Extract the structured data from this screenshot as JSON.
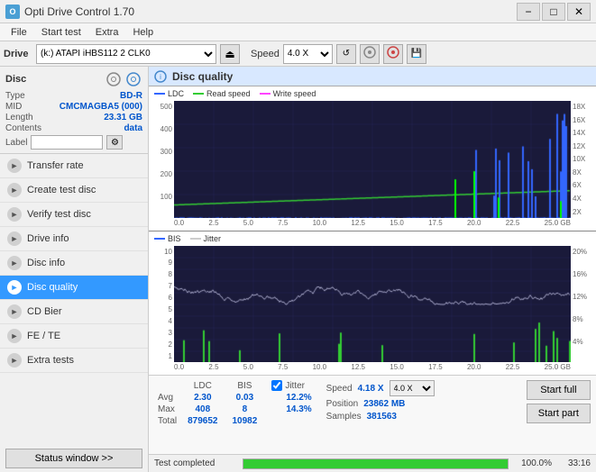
{
  "titlebar": {
    "title": "Opti Drive Control 1.70",
    "icon_text": "O",
    "minimize_label": "−",
    "maximize_label": "□",
    "close_label": "✕"
  },
  "menubar": {
    "items": [
      "File",
      "Start test",
      "Extra",
      "Help"
    ]
  },
  "drive": {
    "label": "Drive",
    "value": "(k:)  ATAPI iHBS112  2 CLK0",
    "speed_label": "Speed",
    "speed_value": "4.0 X"
  },
  "disc": {
    "section_title": "Disc",
    "type_label": "Type",
    "type_value": "BD-R",
    "mid_label": "MID",
    "mid_value": "CMCMAGBA5 (000)",
    "length_label": "Length",
    "length_value": "23.31 GB",
    "contents_label": "Contents",
    "contents_value": "data",
    "label_label": "Label",
    "label_value": ""
  },
  "nav": {
    "items": [
      {
        "id": "transfer-rate",
        "label": "Transfer rate",
        "active": false
      },
      {
        "id": "create-test-disc",
        "label": "Create test disc",
        "active": false
      },
      {
        "id": "verify-test-disc",
        "label": "Verify test disc",
        "active": false
      },
      {
        "id": "drive-info",
        "label": "Drive info",
        "active": false
      },
      {
        "id": "disc-info",
        "label": "Disc info",
        "active": false
      },
      {
        "id": "disc-quality",
        "label": "Disc quality",
        "active": true
      },
      {
        "id": "cd-bier",
        "label": "CD Bier",
        "active": false
      },
      {
        "id": "fe-te",
        "label": "FE / TE",
        "active": false
      },
      {
        "id": "extra-tests",
        "label": "Extra tests",
        "active": false
      }
    ]
  },
  "status_btn": "Status window >>",
  "quality": {
    "title": "Disc quality",
    "legend": {
      "ldc_label": "LDC",
      "read_speed_label": "Read speed",
      "write_speed_label": "Write speed",
      "bis_label": "BIS",
      "jitter_label": "Jitter"
    }
  },
  "chart_top": {
    "y_labels_left": [
      "500",
      "400",
      "300",
      "200",
      "100",
      "0.0"
    ],
    "y_labels_right": [
      "18X",
      "16X",
      "14X",
      "12X",
      "10X",
      "8X",
      "6X",
      "4X",
      "2X"
    ],
    "x_labels": [
      "0.0",
      "2.5",
      "5.0",
      "7.5",
      "10.0",
      "12.5",
      "15.0",
      "17.5",
      "20.0",
      "22.5",
      "25.0 GB"
    ]
  },
  "chart_bottom": {
    "y_labels_left": [
      "10",
      "9",
      "8",
      "7",
      "6",
      "5",
      "4",
      "3",
      "2",
      "1"
    ],
    "y_labels_right": [
      "20%",
      "16%",
      "12%",
      "8%",
      "4%"
    ],
    "x_labels": [
      "0.0",
      "2.5",
      "5.0",
      "7.5",
      "10.0",
      "12.5",
      "15.0",
      "17.5",
      "20.0",
      "22.5",
      "25.0 GB"
    ]
  },
  "stats": {
    "headers": [
      "LDC",
      "BIS",
      "",
      "Jitter",
      "Speed"
    ],
    "avg_label": "Avg",
    "avg_ldc": "2.30",
    "avg_bis": "0.03",
    "avg_jitter": "12.2%",
    "max_label": "Max",
    "max_ldc": "408",
    "max_bis": "8",
    "max_jitter": "14.3%",
    "total_label": "Total",
    "total_ldc": "879652",
    "total_bis": "10982",
    "speed_label": "Speed",
    "speed_value": "4.18 X",
    "speed_dropdown": "4.0 X",
    "position_label": "Position",
    "position_value": "23862 MB",
    "samples_label": "Samples",
    "samples_value": "381563",
    "jitter_checked": true,
    "start_full_label": "Start full",
    "start_part_label": "Start part"
  },
  "progress": {
    "status": "Test completed",
    "percent": "100.0%",
    "fill_width": 100,
    "time": "33:16"
  }
}
